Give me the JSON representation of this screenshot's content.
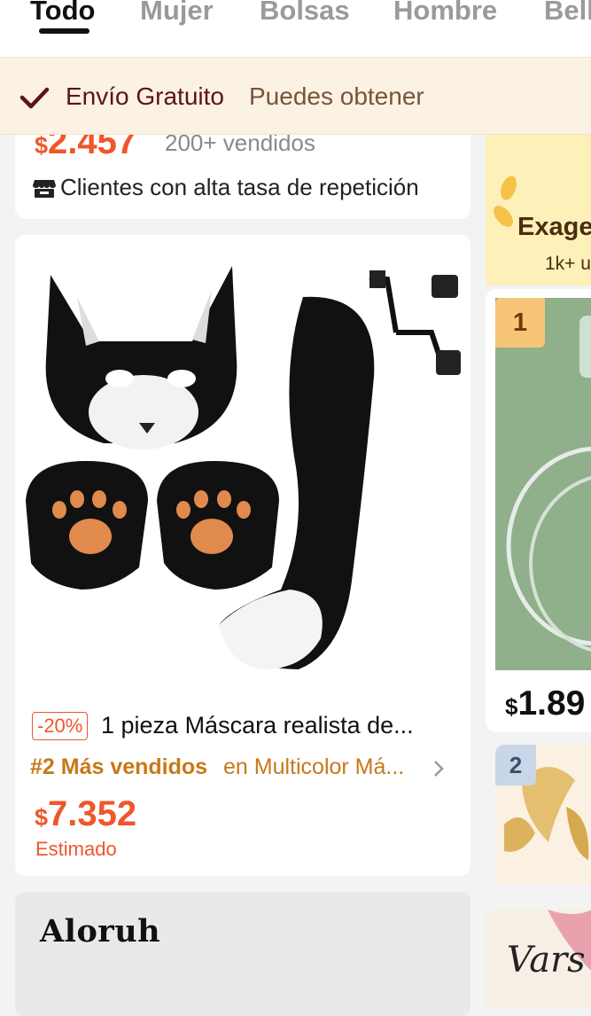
{
  "tabs": [
    {
      "label": "Todo",
      "active": true
    },
    {
      "label": "Mujer",
      "active": false
    },
    {
      "label": "Bolsas",
      "active": false
    },
    {
      "label": "Hombre",
      "active": false
    },
    {
      "label": "Bell",
      "active": false
    }
  ],
  "banner": {
    "title": "Envío Gratuito",
    "subtitle": "Puedes obtener",
    "icon": "check-icon",
    "bg_color": "#fcf2e3"
  },
  "left_top_card": {
    "currency": "$",
    "price": "2.457",
    "sold": "200+ vendidos",
    "tag": "Clientes con alta tasa de repetición",
    "tag_icon": "store-icon"
  },
  "main_product": {
    "discount": "-20%",
    "title": "1 pieza Máscara realista de...",
    "rank_label": "#2 Más vendidos",
    "rank_category": "en Multicolor Má...",
    "currency": "$",
    "price": "7.352",
    "price_note": "Estimado",
    "accent_color": "#f0562a"
  },
  "brand_card": {
    "logo_text": "Aloruh"
  },
  "right_column": {
    "promo_title": "Exage",
    "promo_sub": "1k+ u",
    "ranked_items": [
      {
        "rank": "1",
        "currency": "$",
        "price": "1.89"
      },
      {
        "rank": "2"
      }
    ],
    "bottom_logo_text": "Vars"
  }
}
